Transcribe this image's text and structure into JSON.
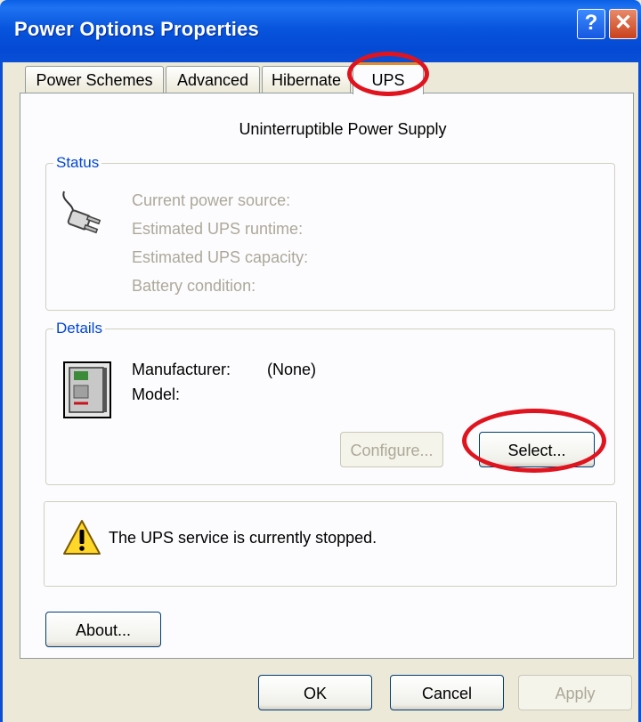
{
  "window": {
    "title": "Power Options Properties",
    "help_glyph": "?",
    "close_glyph": "✕"
  },
  "tabs": [
    {
      "label": "Power Schemes",
      "active": false
    },
    {
      "label": "Advanced",
      "active": false
    },
    {
      "label": "Hibernate",
      "active": false
    },
    {
      "label": "UPS",
      "active": true
    }
  ],
  "ups": {
    "heading": "Uninterruptible Power Supply",
    "status": {
      "legend": "Status",
      "icon": "power-plug-icon",
      "rows": [
        "Current power source:",
        "Estimated UPS runtime:",
        "Estimated UPS capacity:",
        "Battery condition:"
      ]
    },
    "details": {
      "legend": "Details",
      "icon": "ups-device-icon",
      "manufacturer_label": "Manufacturer:",
      "manufacturer_value": "(None)",
      "model_label": "Model:",
      "configure_label": "Configure...",
      "select_label": "Select..."
    },
    "notice": {
      "icon": "warning-icon",
      "text": "The UPS service is currently stopped."
    },
    "about_label": "About..."
  },
  "dialog_buttons": {
    "ok": "OK",
    "cancel": "Cancel",
    "apply": "Apply"
  },
  "annotations": {
    "highlight_color": "#e0141e"
  }
}
